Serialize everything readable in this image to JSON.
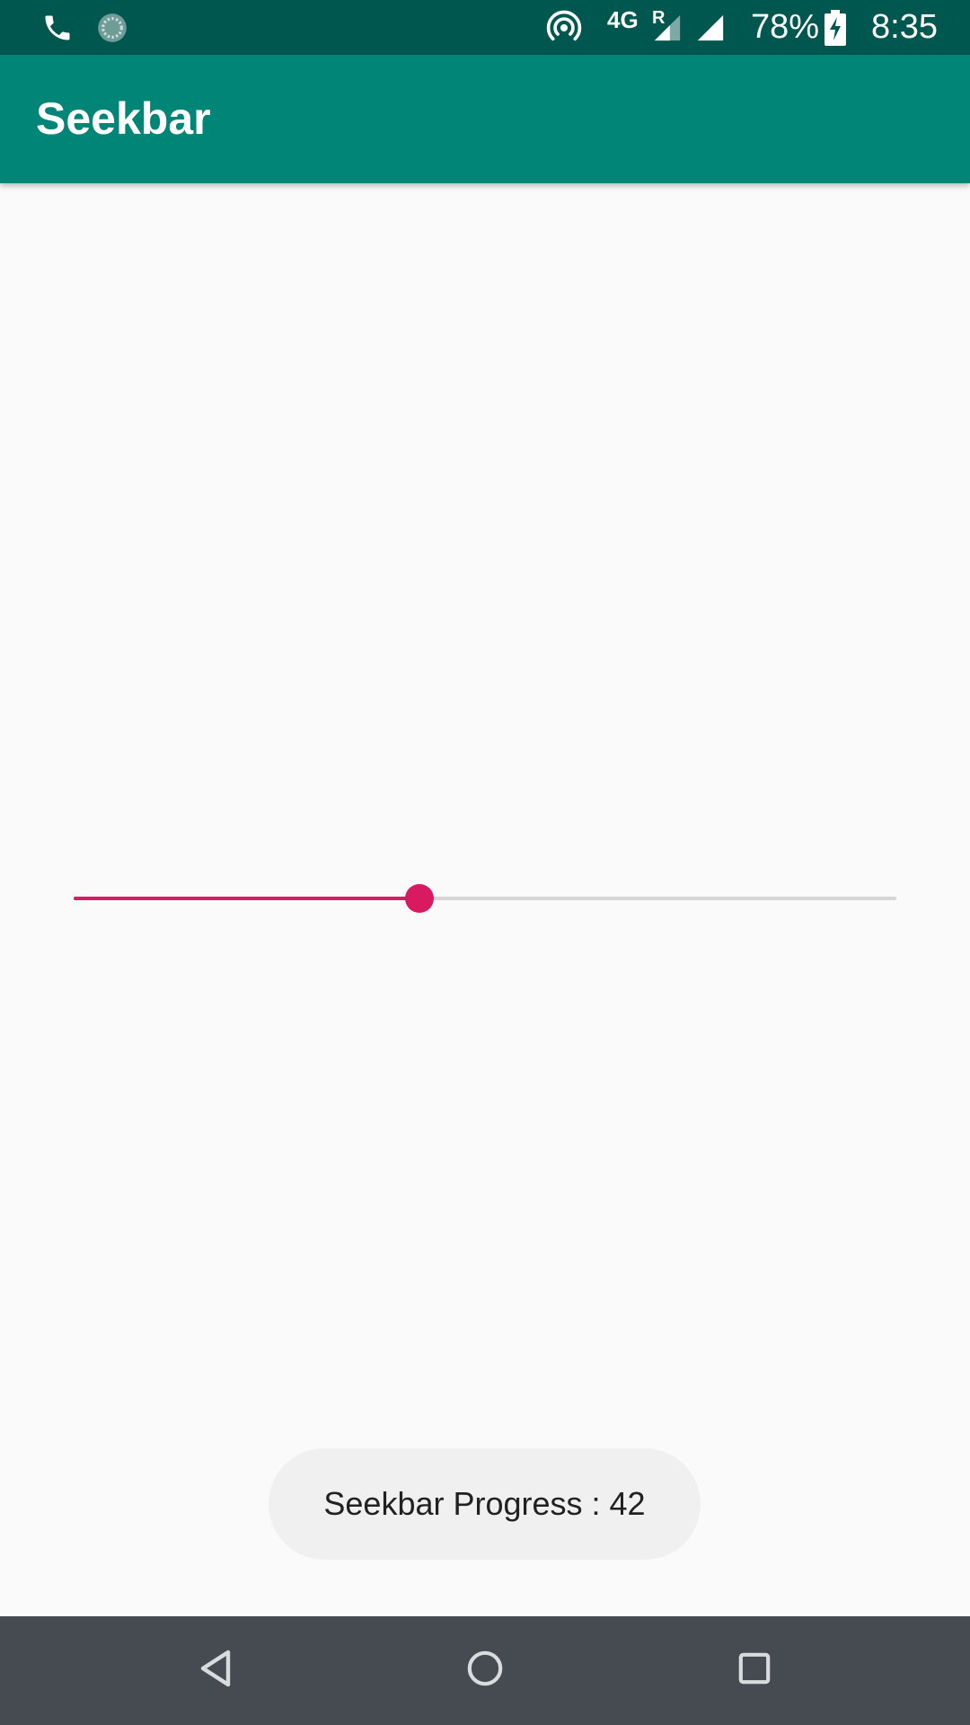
{
  "status_bar": {
    "icons": [
      "phone-icon",
      "sync-icon",
      "hotspot-icon",
      "signal-roaming-icon",
      "signal-icon",
      "battery-charging-icon"
    ],
    "network_type": "4G",
    "roaming_mark": "R",
    "battery_percent": "78%",
    "time": "8:35"
  },
  "app_bar": {
    "title": "Seekbar",
    "color": "#008577"
  },
  "seekbar": {
    "progress": 42,
    "max": 100,
    "accent_color": "#d81b60"
  },
  "toast": {
    "message": "Seekbar  Progress : 42"
  },
  "nav_bar": {
    "icons": [
      "back-icon",
      "home-icon",
      "recents-icon"
    ]
  }
}
